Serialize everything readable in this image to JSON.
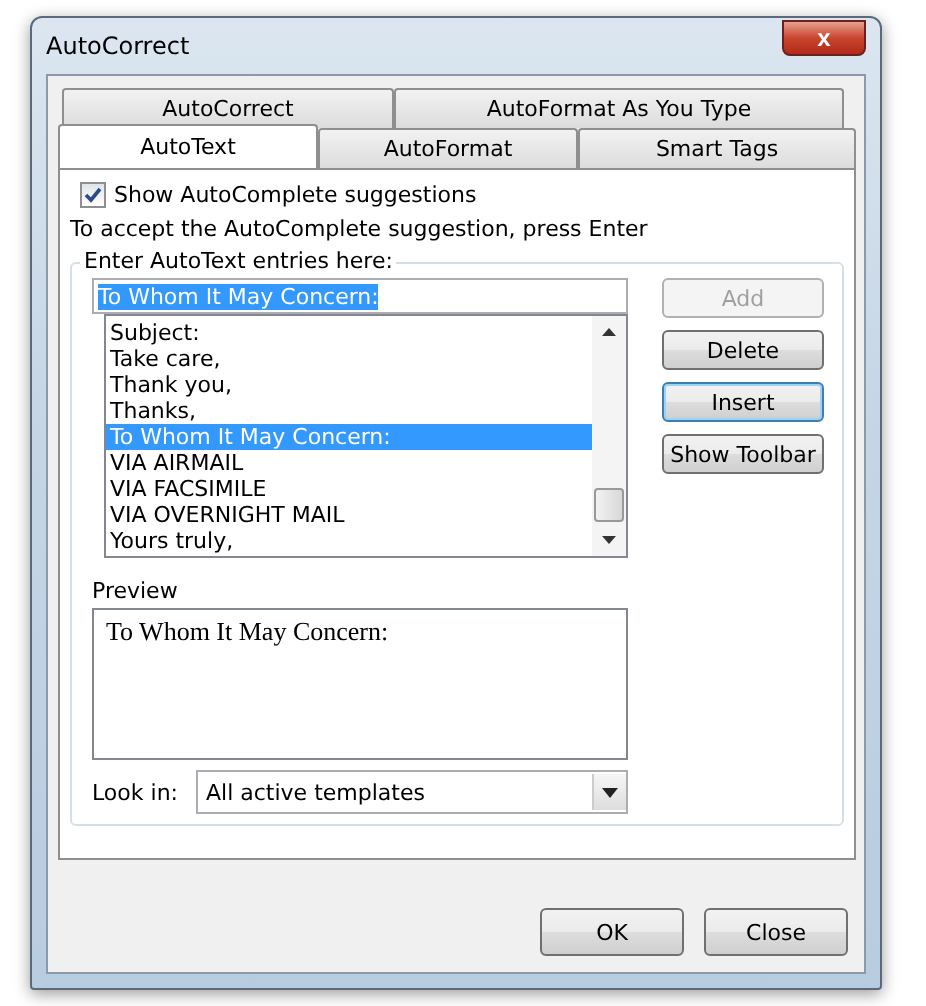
{
  "window": {
    "title": "AutoCorrect",
    "close": "x"
  },
  "tab_rows": [
    [
      {
        "label": "AutoCorrect",
        "selected": false
      },
      {
        "label": "AutoFormat As You Type",
        "selected": false
      }
    ],
    [
      {
        "label": "AutoText",
        "selected": true
      },
      {
        "label": "AutoFormat",
        "selected": false
      },
      {
        "label": "Smart Tags",
        "selected": false
      }
    ]
  ],
  "show_autocomplete": {
    "label": "Show AutoComplete suggestions",
    "checked": true
  },
  "hint": "To accept the AutoComplete suggestion, press Enter",
  "entries_group": {
    "label": "Enter AutoText entries here:",
    "value": "To Whom It May Concern:",
    "items": [
      {
        "label": "Subject:",
        "selected": false
      },
      {
        "label": "Take care,",
        "selected": false
      },
      {
        "label": "Thank you,",
        "selected": false
      },
      {
        "label": "Thanks,",
        "selected": false
      },
      {
        "label": "To Whom It May Concern:",
        "selected": true
      },
      {
        "label": "VIA AIRMAIL",
        "selected": false
      },
      {
        "label": "VIA FACSIMILE",
        "selected": false
      },
      {
        "label": "VIA OVERNIGHT MAIL",
        "selected": false
      },
      {
        "label": "Yours truly,",
        "selected": false
      }
    ],
    "buttons": [
      {
        "label": "Add",
        "disabled": true,
        "focused": false
      },
      {
        "label": "Delete",
        "disabled": false,
        "focused": false
      },
      {
        "label": "Insert",
        "disabled": false,
        "focused": true
      },
      {
        "label": "Show Toolbar",
        "disabled": false,
        "focused": false
      }
    ],
    "preview_label": "Preview",
    "preview_text": "To Whom It May Concern:",
    "look_in_label": "Look in:",
    "look_in_value": "All active templates"
  },
  "buttons": [
    "OK",
    "Close"
  ]
}
